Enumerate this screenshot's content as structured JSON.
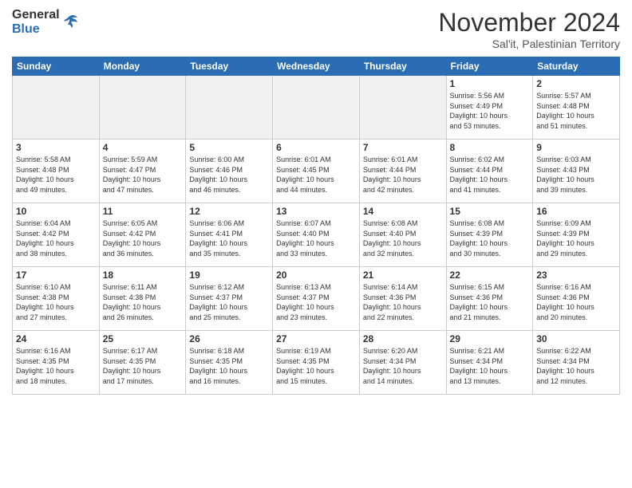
{
  "header": {
    "logo_general": "General",
    "logo_blue": "Blue",
    "month_title": "November 2024",
    "location": "Sal'it, Palestinian Territory"
  },
  "weekdays": [
    "Sunday",
    "Monday",
    "Tuesday",
    "Wednesday",
    "Thursday",
    "Friday",
    "Saturday"
  ],
  "weeks": [
    [
      {
        "day": "",
        "info": ""
      },
      {
        "day": "",
        "info": ""
      },
      {
        "day": "",
        "info": ""
      },
      {
        "day": "",
        "info": ""
      },
      {
        "day": "",
        "info": ""
      },
      {
        "day": "1",
        "info": "Sunrise: 5:56 AM\nSunset: 4:49 PM\nDaylight: 10 hours\nand 53 minutes."
      },
      {
        "day": "2",
        "info": "Sunrise: 5:57 AM\nSunset: 4:48 PM\nDaylight: 10 hours\nand 51 minutes."
      }
    ],
    [
      {
        "day": "3",
        "info": "Sunrise: 5:58 AM\nSunset: 4:48 PM\nDaylight: 10 hours\nand 49 minutes."
      },
      {
        "day": "4",
        "info": "Sunrise: 5:59 AM\nSunset: 4:47 PM\nDaylight: 10 hours\nand 47 minutes."
      },
      {
        "day": "5",
        "info": "Sunrise: 6:00 AM\nSunset: 4:46 PM\nDaylight: 10 hours\nand 46 minutes."
      },
      {
        "day": "6",
        "info": "Sunrise: 6:01 AM\nSunset: 4:45 PM\nDaylight: 10 hours\nand 44 minutes."
      },
      {
        "day": "7",
        "info": "Sunrise: 6:01 AM\nSunset: 4:44 PM\nDaylight: 10 hours\nand 42 minutes."
      },
      {
        "day": "8",
        "info": "Sunrise: 6:02 AM\nSunset: 4:44 PM\nDaylight: 10 hours\nand 41 minutes."
      },
      {
        "day": "9",
        "info": "Sunrise: 6:03 AM\nSunset: 4:43 PM\nDaylight: 10 hours\nand 39 minutes."
      }
    ],
    [
      {
        "day": "10",
        "info": "Sunrise: 6:04 AM\nSunset: 4:42 PM\nDaylight: 10 hours\nand 38 minutes."
      },
      {
        "day": "11",
        "info": "Sunrise: 6:05 AM\nSunset: 4:42 PM\nDaylight: 10 hours\nand 36 minutes."
      },
      {
        "day": "12",
        "info": "Sunrise: 6:06 AM\nSunset: 4:41 PM\nDaylight: 10 hours\nand 35 minutes."
      },
      {
        "day": "13",
        "info": "Sunrise: 6:07 AM\nSunset: 4:40 PM\nDaylight: 10 hours\nand 33 minutes."
      },
      {
        "day": "14",
        "info": "Sunrise: 6:08 AM\nSunset: 4:40 PM\nDaylight: 10 hours\nand 32 minutes."
      },
      {
        "day": "15",
        "info": "Sunrise: 6:08 AM\nSunset: 4:39 PM\nDaylight: 10 hours\nand 30 minutes."
      },
      {
        "day": "16",
        "info": "Sunrise: 6:09 AM\nSunset: 4:39 PM\nDaylight: 10 hours\nand 29 minutes."
      }
    ],
    [
      {
        "day": "17",
        "info": "Sunrise: 6:10 AM\nSunset: 4:38 PM\nDaylight: 10 hours\nand 27 minutes."
      },
      {
        "day": "18",
        "info": "Sunrise: 6:11 AM\nSunset: 4:38 PM\nDaylight: 10 hours\nand 26 minutes."
      },
      {
        "day": "19",
        "info": "Sunrise: 6:12 AM\nSunset: 4:37 PM\nDaylight: 10 hours\nand 25 minutes."
      },
      {
        "day": "20",
        "info": "Sunrise: 6:13 AM\nSunset: 4:37 PM\nDaylight: 10 hours\nand 23 minutes."
      },
      {
        "day": "21",
        "info": "Sunrise: 6:14 AM\nSunset: 4:36 PM\nDaylight: 10 hours\nand 22 minutes."
      },
      {
        "day": "22",
        "info": "Sunrise: 6:15 AM\nSunset: 4:36 PM\nDaylight: 10 hours\nand 21 minutes."
      },
      {
        "day": "23",
        "info": "Sunrise: 6:16 AM\nSunset: 4:36 PM\nDaylight: 10 hours\nand 20 minutes."
      }
    ],
    [
      {
        "day": "24",
        "info": "Sunrise: 6:16 AM\nSunset: 4:35 PM\nDaylight: 10 hours\nand 18 minutes."
      },
      {
        "day": "25",
        "info": "Sunrise: 6:17 AM\nSunset: 4:35 PM\nDaylight: 10 hours\nand 17 minutes."
      },
      {
        "day": "26",
        "info": "Sunrise: 6:18 AM\nSunset: 4:35 PM\nDaylight: 10 hours\nand 16 minutes."
      },
      {
        "day": "27",
        "info": "Sunrise: 6:19 AM\nSunset: 4:35 PM\nDaylight: 10 hours\nand 15 minutes."
      },
      {
        "day": "28",
        "info": "Sunrise: 6:20 AM\nSunset: 4:34 PM\nDaylight: 10 hours\nand 14 minutes."
      },
      {
        "day": "29",
        "info": "Sunrise: 6:21 AM\nSunset: 4:34 PM\nDaylight: 10 hours\nand 13 minutes."
      },
      {
        "day": "30",
        "info": "Sunrise: 6:22 AM\nSunset: 4:34 PM\nDaylight: 10 hours\nand 12 minutes."
      }
    ]
  ]
}
